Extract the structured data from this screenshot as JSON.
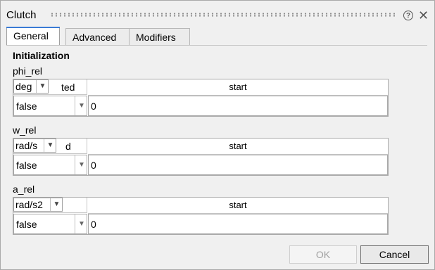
{
  "window": {
    "title": "Clutch"
  },
  "icons": {
    "help": "help-icon",
    "close": "close-icon"
  },
  "tabs": [
    {
      "label": "General",
      "active": true
    },
    {
      "label": "Advanced",
      "active": false
    },
    {
      "label": "Modifiers",
      "active": false
    }
  ],
  "section": {
    "title": "Initialization"
  },
  "variables": [
    {
      "name": "phi_rel",
      "unit": "deg",
      "fixed_header_fragment": "ted",
      "start_header": "start",
      "fixed_value": "false",
      "start_value": "0"
    },
    {
      "name": "w_rel",
      "unit": "rad/s",
      "fixed_header_fragment": "d",
      "start_header": "start",
      "fixed_value": "false",
      "start_value": "0"
    },
    {
      "name": "a_rel",
      "unit": "rad/s2",
      "fixed_header_fragment": "",
      "start_header": "start",
      "fixed_value": "false",
      "start_value": "0"
    }
  ],
  "buttons": {
    "ok": "OK",
    "cancel": "Cancel"
  },
  "colors": {
    "tab_accent": "#3a7bd5",
    "background": "#f0f0f0"
  }
}
